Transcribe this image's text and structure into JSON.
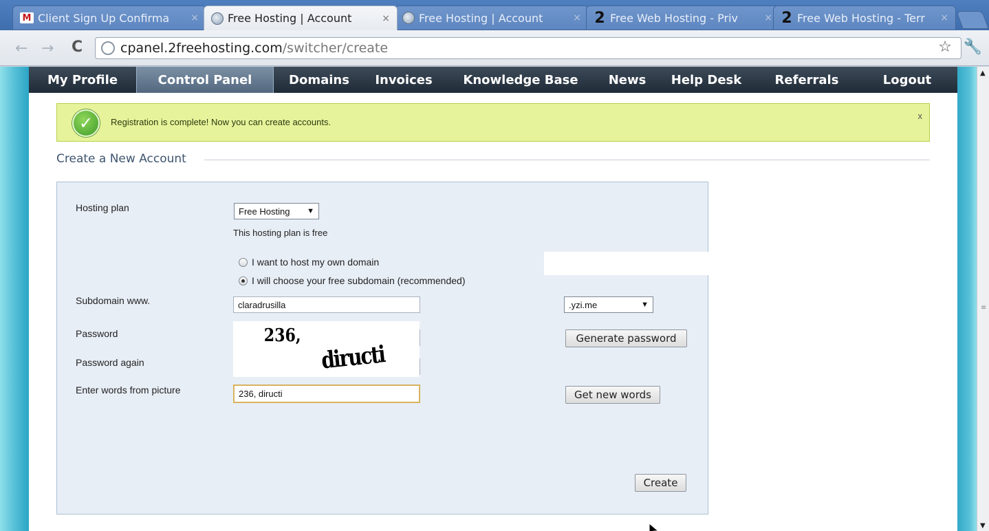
{
  "browser": {
    "tabs": [
      {
        "title": "Client Sign Up Confirma",
        "icon": "gmail-icon",
        "active": false
      },
      {
        "title": "Free Hosting | Account",
        "icon": "globe-icon",
        "active": true
      },
      {
        "title": "Free Hosting | Account",
        "icon": "globe-icon",
        "active": false
      },
      {
        "title": "Free Web Hosting - Priv",
        "icon": "2freehosting-icon",
        "active": false
      },
      {
        "title": "Free Web Hosting - Terr",
        "icon": "2freehosting-icon",
        "active": false
      }
    ],
    "close_glyph": "×",
    "url_domain": "cpanel.2freehosting.com",
    "url_path": "/switcher/create"
  },
  "nav": {
    "items": [
      {
        "label": "My Profile"
      },
      {
        "label": "Control Panel",
        "active": true
      },
      {
        "label": "Domains"
      },
      {
        "label": "Invoices"
      },
      {
        "label": "Knowledge Base"
      },
      {
        "label": "News"
      },
      {
        "label": "Help Desk"
      },
      {
        "label": "Referrals"
      },
      {
        "label": "Logout"
      }
    ]
  },
  "notice": {
    "text": "Registration is complete! Now you can create accounts.",
    "close": "x",
    "color": "#e6f39a"
  },
  "form": {
    "legend": "Create a New Account",
    "hosting_plan_label": "Hosting plan",
    "hosting_plan_value": "Free Hosting",
    "hosting_plan_note": "This hosting plan is free",
    "radio_own_domain": "I want to host my own domain",
    "radio_subdomain": "I will choose your free subdomain (recommended)",
    "subdomain_label": "Subdomain www.",
    "subdomain_value": "claradrusilla",
    "domain_suffix": ".yzi.me",
    "password_label": "Password",
    "password_value": "••••••••••••••",
    "password_again_label": "Password again",
    "password_again_value": "••••••••••••••",
    "generate_password": "Generate password",
    "captcha_label": "Enter words from picture",
    "captcha_value": "236, diructi",
    "get_new_words": "Get new words",
    "captcha_image_text_1": "236,",
    "captcha_image_text_2": "diructi",
    "create": "Create",
    "dropdown_arrow": "▼"
  }
}
